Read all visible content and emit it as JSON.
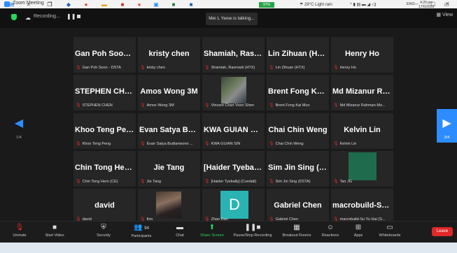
{
  "window": {
    "title": "Zoom Meeting",
    "minimize": "–",
    "maximize": "▢",
    "close": "✕"
  },
  "topbar": {
    "recording_label": "Recording...",
    "pause_glyph": "❚❚",
    "talking": "Mei L Yeow is talking...",
    "view_label": "View"
  },
  "participants": [
    {
      "name": "Gan Poh Soon -...",
      "sub": "Gan Poh Soon - DSTA"
    },
    {
      "name": "kristy chen",
      "sub": "kristy chen"
    },
    {
      "name": "Shamiah, Rasm...",
      "sub": "Shamiah, Rasmadi (HTX)"
    },
    {
      "name": "Lin Zihuan (HTX)",
      "sub": "Lin Zihuan (HTX)"
    },
    {
      "name": "Henry Ho",
      "sub": "Henry Ho"
    },
    {
      "name": "STEPHEN CHEN",
      "sub": "STEPHEN CHEN"
    },
    {
      "name": "Amos Wong 3M",
      "sub": "Amos Wong 3M"
    },
    {
      "name": "",
      "sub": "Vincent Chan Voon Shen"
    },
    {
      "name": "Brent Fong Kai...",
      "sub": "Brent Fong Kai Mun"
    },
    {
      "name": "Md Mizanur Ra...",
      "sub": "Md Mizanur Rahman-Mo..."
    },
    {
      "name": "Khoo Teng Peng",
      "sub": "Khoo Teng Peng"
    },
    {
      "name": "Evan Satya Budi...",
      "sub": "Evan Satya Budianwono ..."
    },
    {
      "name": "KWA GUIAN SIN",
      "sub": "KWA GUIAN SIN"
    },
    {
      "name": "Chai Chin Weng",
      "sub": "Chai Chin Weng"
    },
    {
      "name": "Kelvin Lin",
      "sub": "Kelvin Lin"
    },
    {
      "name": "Chin Tong Hern...",
      "sub": "Chin Tong Hern (CE)"
    },
    {
      "name": "Jie Tang",
      "sub": "Jie Tang"
    },
    {
      "name": "[Haider Tyeball...",
      "sub": "[Haider Tyebally] (Cundall)"
    },
    {
      "name": "Sim Jin Sing (D...",
      "sub": "Sim Jin Sing (DSTA)"
    },
    {
      "name": "",
      "sub": "Tan JG"
    },
    {
      "name": "david",
      "sub": "david"
    },
    {
      "name": "",
      "sub": "finn"
    },
    {
      "name": "",
      "sub": "Zhao Dan",
      "avatar_letter": "D"
    },
    {
      "name": "Gabriel Chen",
      "sub": "Gabriel Chen"
    },
    {
      "name": "macrobuild-Su...",
      "sub": "macrobuild-Su Yu Hai (S..."
    }
  ],
  "nav": {
    "left_glyph": "◀",
    "left_page": "1/4",
    "right_glyph": "▶",
    "right_page": "3/4"
  },
  "toolbar": {
    "unmute": "Unmute",
    "start_video": "Start Video",
    "security": "Security",
    "participants": "Participants",
    "participants_count": "94",
    "chat": "Chat",
    "share_screen": "Share Screen",
    "record": "Pause/Stop Recording",
    "breakout": "Breakout Rooms",
    "reactions": "Reactions",
    "apps": "Apps",
    "whiteboards": "Whiteboards",
    "leave": "Leave"
  },
  "taskbar": {
    "battery": "97%",
    "weather": "29°C  Light rain",
    "lang": "ENG",
    "time": "4:20 pm",
    "date": "17/6/2022"
  }
}
